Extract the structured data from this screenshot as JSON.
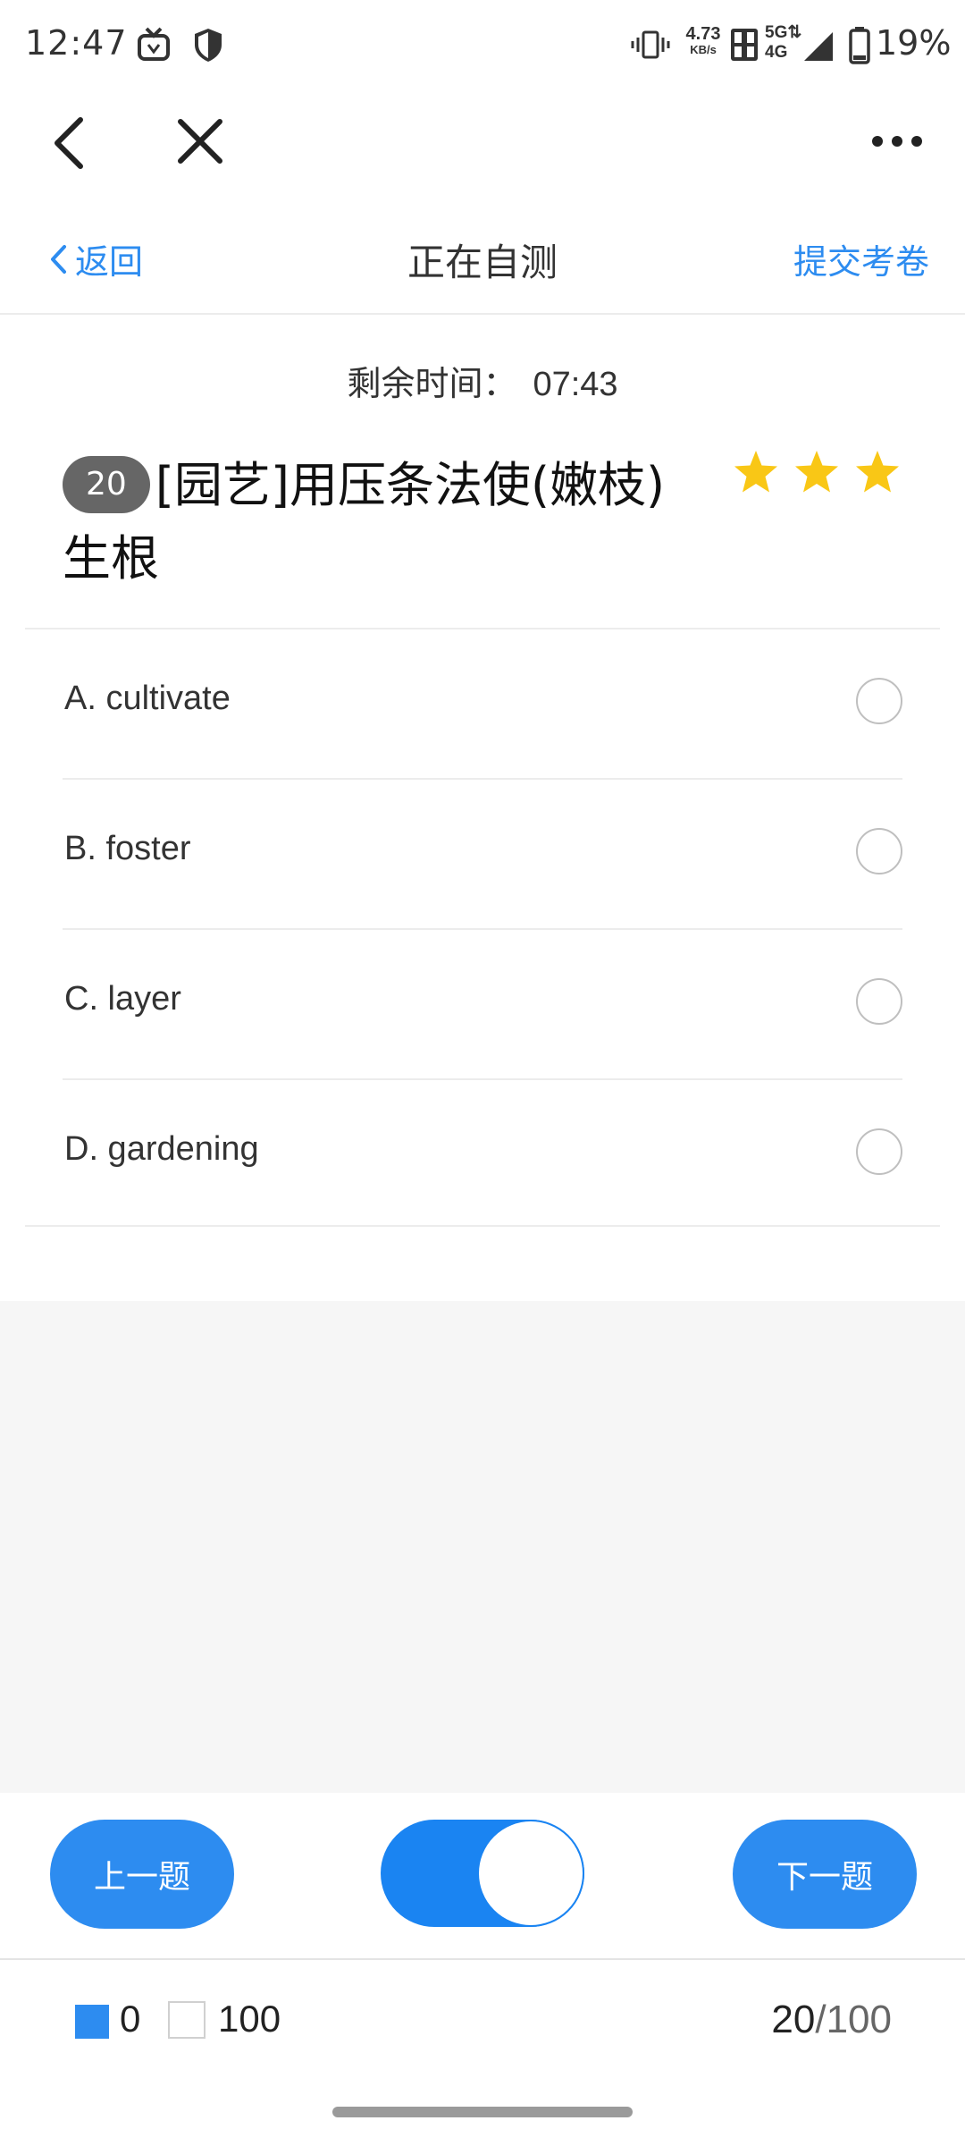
{
  "status_bar": {
    "time": "12:47",
    "network_speed_value": "4.73",
    "network_speed_unit": "KB/s",
    "network_5g": "5G",
    "network_4g": "4G",
    "battery": "19%",
    "icons": [
      "tv-icon",
      "shield-icon",
      "vibrate-icon",
      "hd-icon",
      "signal-icon",
      "battery-icon"
    ]
  },
  "toolbar": {
    "icons": [
      "back-arrow-icon",
      "close-icon",
      "more-icon"
    ]
  },
  "header": {
    "back_label": "返回",
    "title": "正在自测",
    "submit_label": "提交考卷"
  },
  "timer": {
    "label": "剩余时间：",
    "value": "07:43"
  },
  "question": {
    "number": "20",
    "text": "[园艺]用压条法使(嫩枝)生根",
    "difficulty_stars": 3
  },
  "options": [
    {
      "label": "A. cultivate",
      "selected": false
    },
    {
      "label": "B. foster",
      "selected": false
    },
    {
      "label": "C. layer",
      "selected": false
    },
    {
      "label": "D. gardening",
      "selected": false
    }
  ],
  "nav": {
    "prev_label": "上一题",
    "next_label": "下一题",
    "toggle_on": true
  },
  "footer": {
    "answered_count": "0",
    "unanswered_count": "100",
    "current": "20",
    "separator_total": "/100"
  },
  "colors": {
    "accent": "#2d8cf0",
    "star": "#f9c716",
    "badge": "#666666"
  }
}
